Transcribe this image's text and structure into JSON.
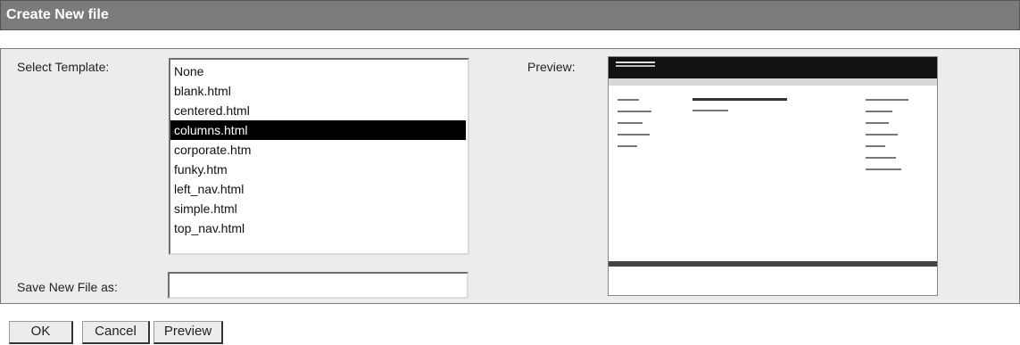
{
  "title": "Create New file",
  "form": {
    "select_template_label": "Select Template:",
    "preview_label": "Preview:",
    "save_label": "Save New File as:",
    "save_value": ""
  },
  "templates": {
    "items": [
      "None",
      "blank.html",
      "centered.html",
      "columns.html",
      "corporate.htm",
      "funky.htm",
      "left_nav.html",
      "simple.html",
      "top_nav.html"
    ],
    "selected": "columns.html"
  },
  "buttons": {
    "ok": "OK",
    "cancel": "Cancel",
    "preview": "Preview"
  }
}
